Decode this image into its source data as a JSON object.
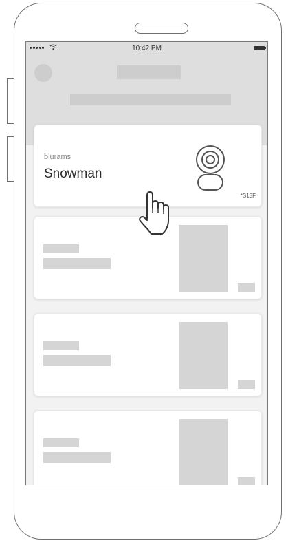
{
  "status_bar": {
    "time": "10:42 PM",
    "signal_icon": "signal-dots-icon",
    "wifi_icon": "wifi-icon",
    "battery_icon": "battery-icon"
  },
  "device_card": {
    "brand": "blurams",
    "device_name": "Snowman",
    "model_code": "*S15F",
    "icon": "security-camera-icon"
  },
  "cursor": {
    "icon": "hand-pointer-icon"
  },
  "colors": {
    "frame": "#6f6f6f",
    "screen_bg": "#f2f2f2",
    "header_bg": "#dedede",
    "placeholder": "#d5d5d5",
    "card_bg": "#ffffff",
    "text_primary": "#2b2b2b",
    "text_secondary": "#8a8a8a"
  }
}
